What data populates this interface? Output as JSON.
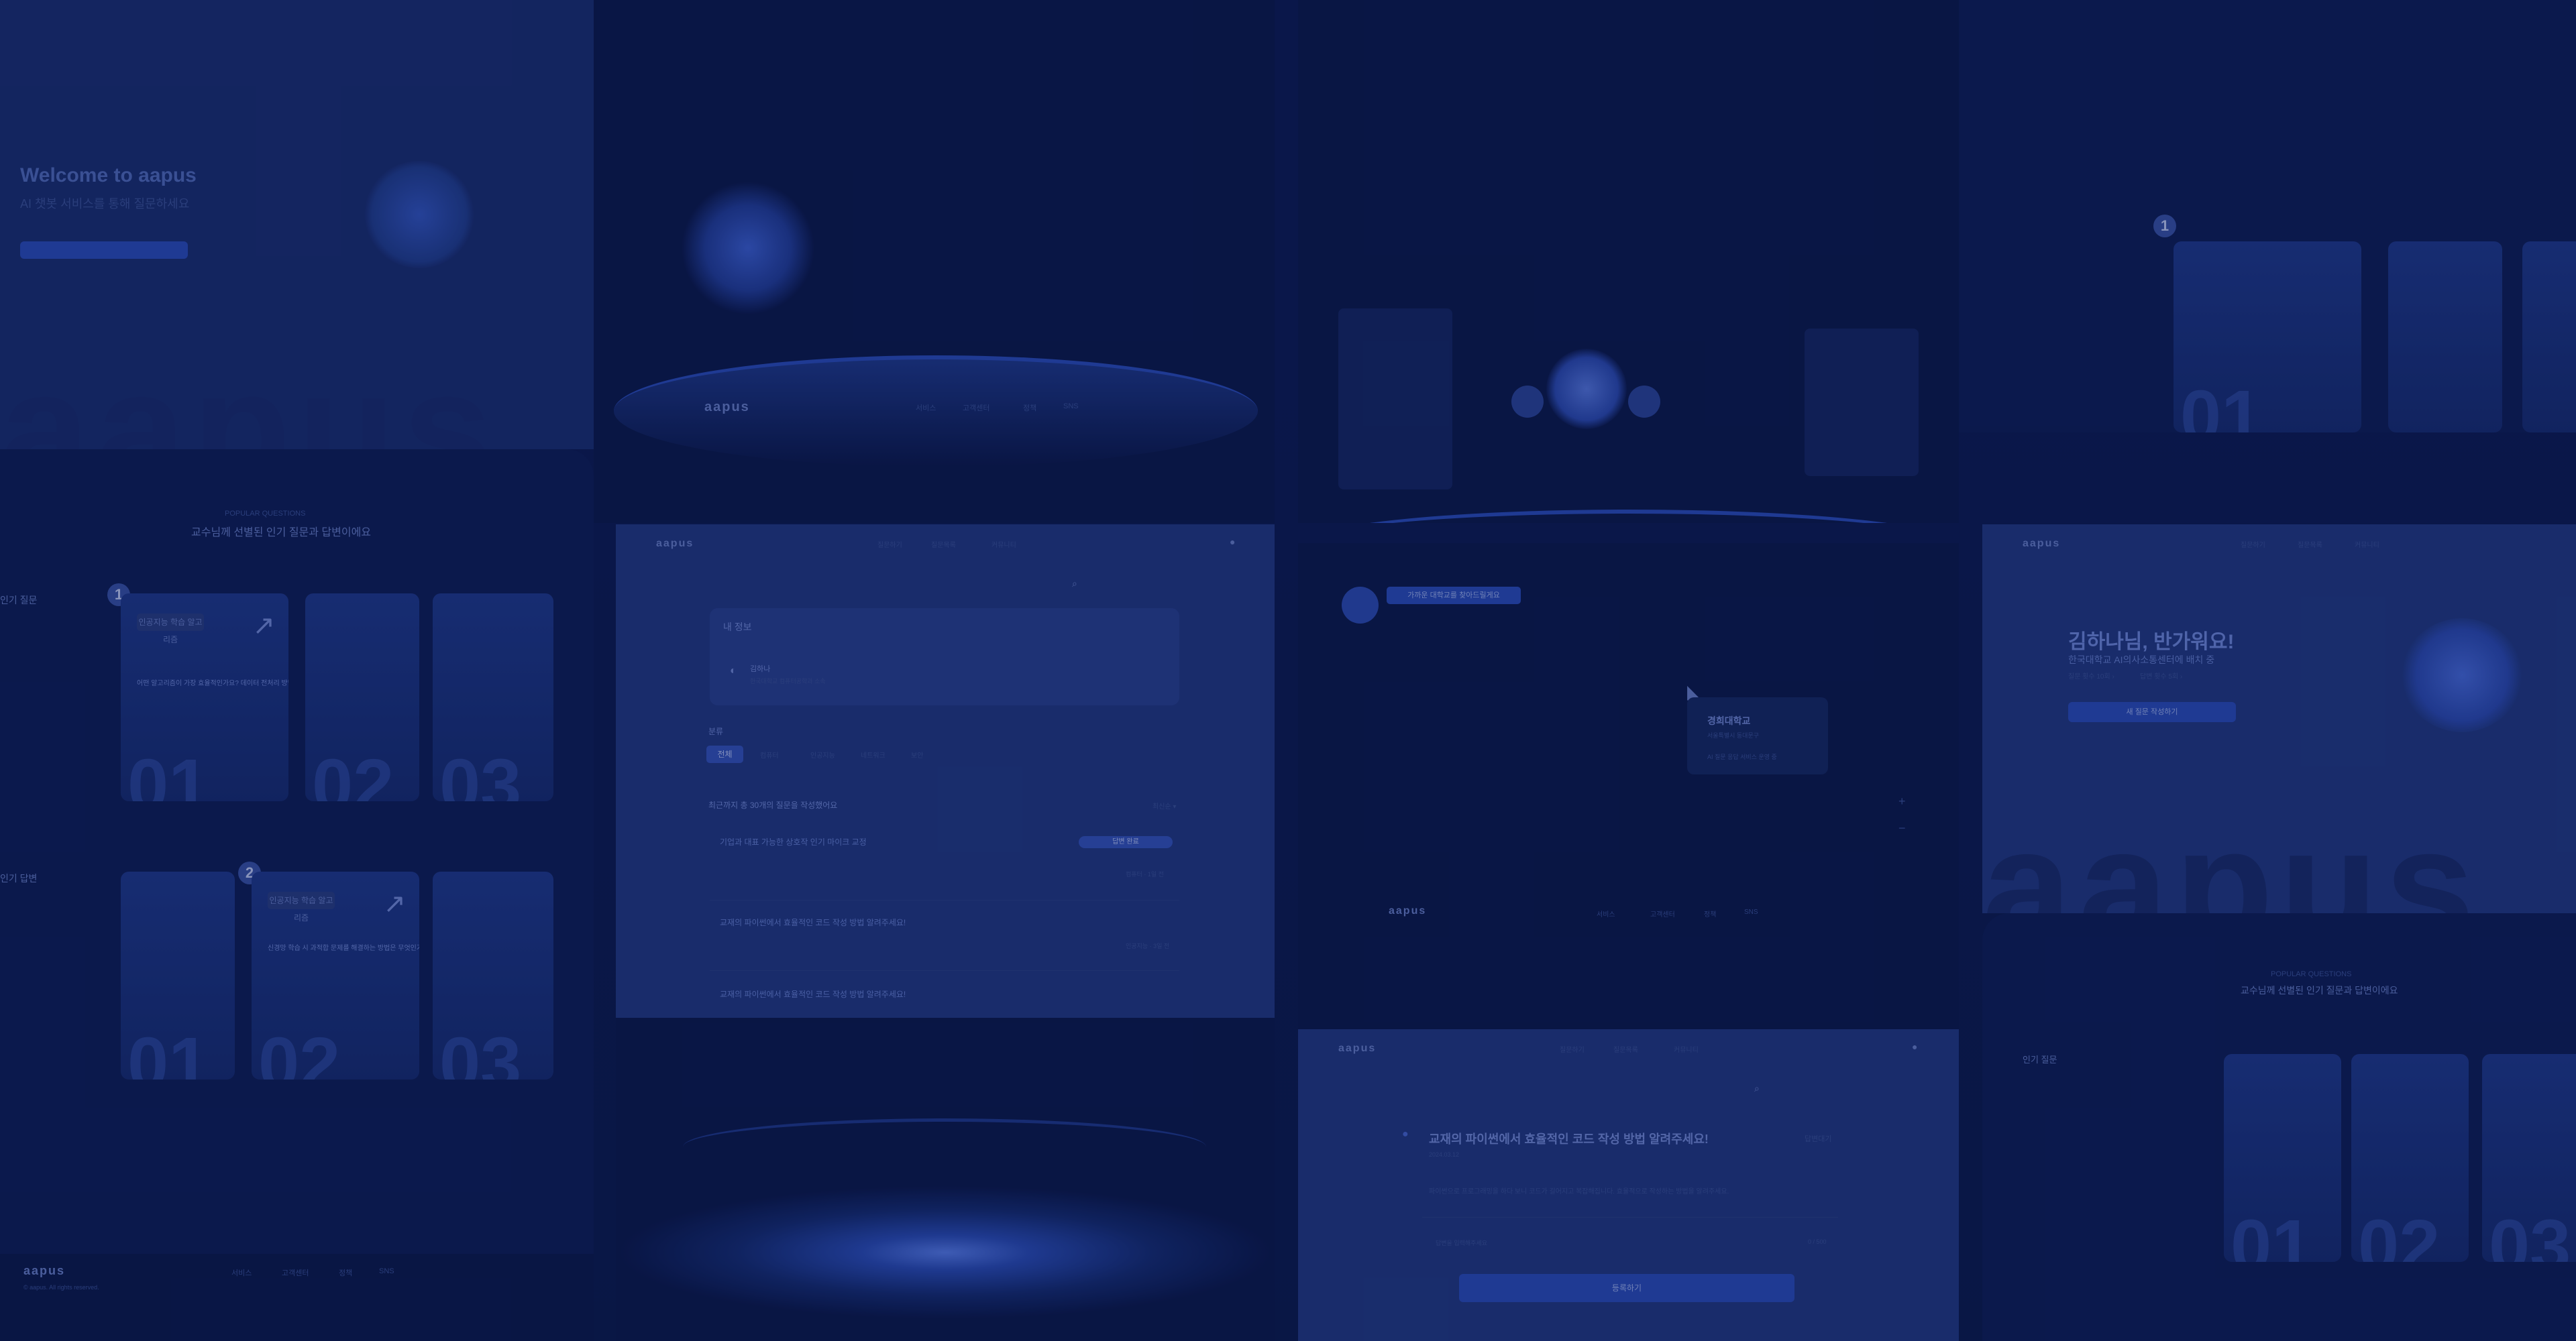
{
  "brand": "aapus",
  "landing": {
    "greeting": "김하나님, 반가워요!",
    "subtitle": "한국대학교 AI의사소통센터에 배치 중",
    "stats": [
      "질문 횟수 10회 ›",
      "답변 횟수 5회 ›"
    ],
    "cta": "새 질문 작성하기",
    "nav": [
      "질문하기",
      "질문목록",
      "커뮤니티"
    ],
    "big_word": "aapus"
  },
  "popular": {
    "kicker": "POPULAR QUESTIONS",
    "title": "교수님께 선별된 인기 질문과 답변이에요",
    "section1": "인기 질문",
    "section2": "인기 답변",
    "card_tag": "인공지능 학습 알고리즘",
    "card_q1": "어떤 알고리즘이 가장 효율적인가요? 데이터 전처리 방법도 궁금합니다",
    "card_q2": "신경망 학습 시 과적합 문제를 해결하는 방법은 무엇인가요?",
    "numbers": [
      "01",
      "02",
      "03"
    ],
    "badges": [
      "1",
      "2"
    ]
  },
  "questions_page": {
    "my_info": "내 정보",
    "user_name": "김하나",
    "user_desc": "한국대학교 컴퓨터공학과 소속",
    "category_title": "분류",
    "tabs": [
      "전체",
      "컴퓨터",
      "인공지능",
      "네트워크",
      "보안"
    ],
    "count_text": "최근까지 총 30개의 질문을 작성했어요",
    "sort": "최신순 ▾",
    "q1_title": "기업과 대표 가능한 상호작 인기 마이크 교정",
    "q1_badge": "답변 완료",
    "q1_meta": "컴퓨터 · 1일 전",
    "q2_title": "교재의 파이썬에서 효율적인 코드 작성 방법 알려주세요!",
    "q2_meta": "인공지능 · 3일 전",
    "q3_title": "교재의 파이썬에서 효율적인 코드 작성 방법 알려주세요!"
  },
  "detail_page": {
    "title": "교재의 파이썬에서 효율적인 코드 작성 방법 알려주세요!",
    "status": "답변대기",
    "date": "2024.03.12",
    "body": "파이썬으로 프로그래밍을 하다 보니 코드가 길어지고 복잡해집니다. 효율적으로 작성하는 방법을 알려주세요.",
    "input_placeholder": "답변을 입력해주세요",
    "input_meta": "0 / 500",
    "submit": "등록하기"
  },
  "map_page": {
    "speech": "가까운 대학교를 찾아드릴게요",
    "university": "경희대학교",
    "uni_sub": "서울특별시 동대문구",
    "uni_desc": "AI 질문 응답 서비스 운영 중"
  },
  "hero_top": {
    "title": "Welcome to aapus",
    "subtitle": "AI 챗봇 서비스를 통해 질문하세요"
  },
  "footer": {
    "cols": [
      "서비스",
      "고객센터",
      "정책",
      "SNS"
    ],
    "copyright": "© aapus. All rights reserved."
  },
  "colors": {
    "background": "#0c1a4e",
    "accent": "#2c4fbd",
    "panel_light": "#1a2e6e"
  }
}
